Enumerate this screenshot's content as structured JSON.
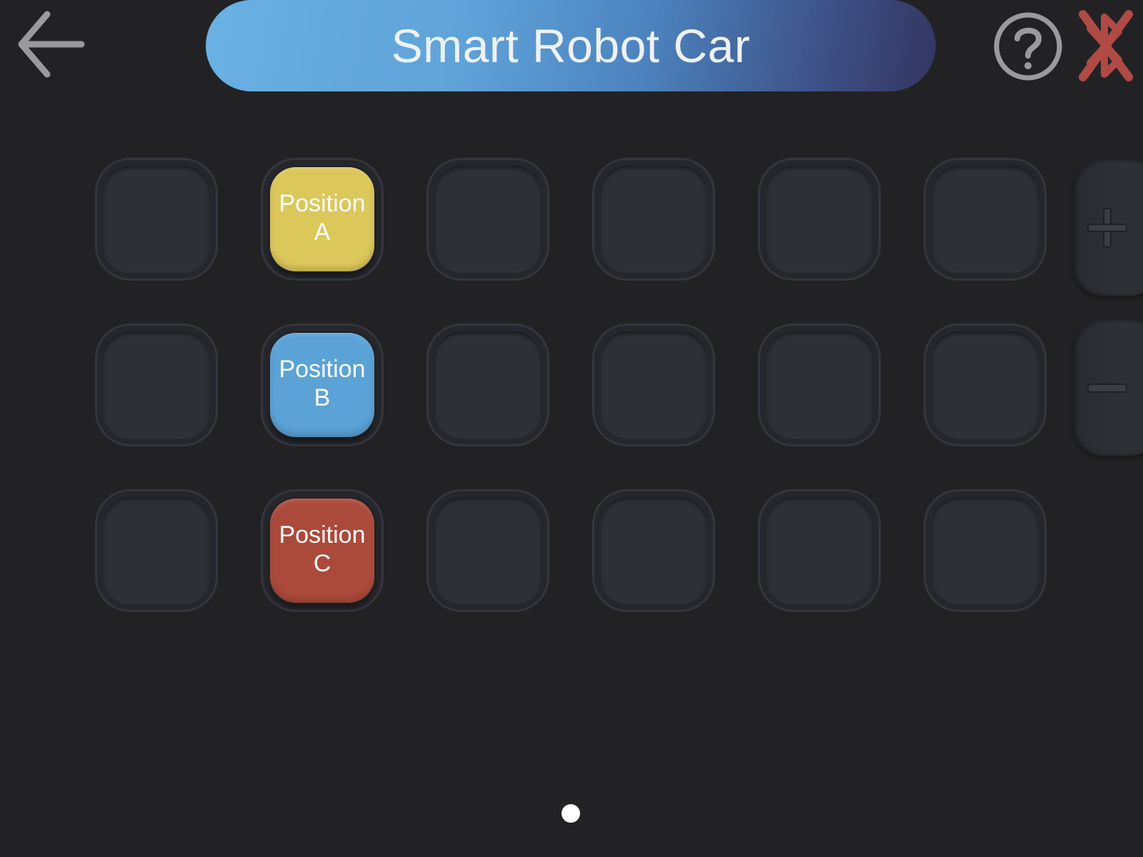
{
  "header": {
    "title": "Smart Robot Car",
    "back_icon": "arrow-left-icon",
    "help_icon": "question-circle-icon",
    "bluetooth_icon": "bluetooth-disconnected-icon"
  },
  "grid": {
    "rows": 3,
    "columns": 6,
    "tiles": [
      {
        "row": 1,
        "column": 2,
        "line1": "Position",
        "line2": "A",
        "color": "#dcc75b"
      },
      {
        "row": 2,
        "column": 2,
        "line1": "Position",
        "line2": "B",
        "color": "#5ba2d6"
      },
      {
        "row": 3,
        "column": 2,
        "line1": "Position",
        "line2": "C",
        "color": "#ab4a3b"
      }
    ]
  },
  "side_buttons": {
    "add_icon": "plus-icon",
    "remove_icon": "minus-icon"
  },
  "pagination": {
    "pages": 1,
    "current": 1
  },
  "colors": {
    "background": "#222225",
    "slot": "#2f3036",
    "title_gradient_start": "#6ab1e4",
    "title_gradient_end": "#333560",
    "bluetooth_disconnected": "#b04a45"
  }
}
